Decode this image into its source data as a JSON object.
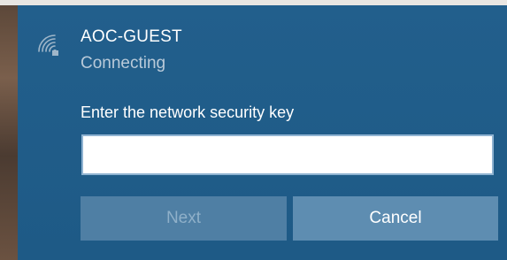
{
  "network": {
    "name": "AOC-GUEST",
    "status": "Connecting",
    "icon": "wifi-secured-icon"
  },
  "security_key": {
    "label": "Enter the network security key",
    "value": "",
    "placeholder": ""
  },
  "buttons": {
    "next_label": "Next",
    "cancel_label": "Cancel"
  },
  "colors": {
    "panel": "#1f5a87",
    "next_disabled_bg": "#4f7fa4",
    "cancel_bg": "#5e8db1",
    "status_text": "#b9cad9"
  }
}
